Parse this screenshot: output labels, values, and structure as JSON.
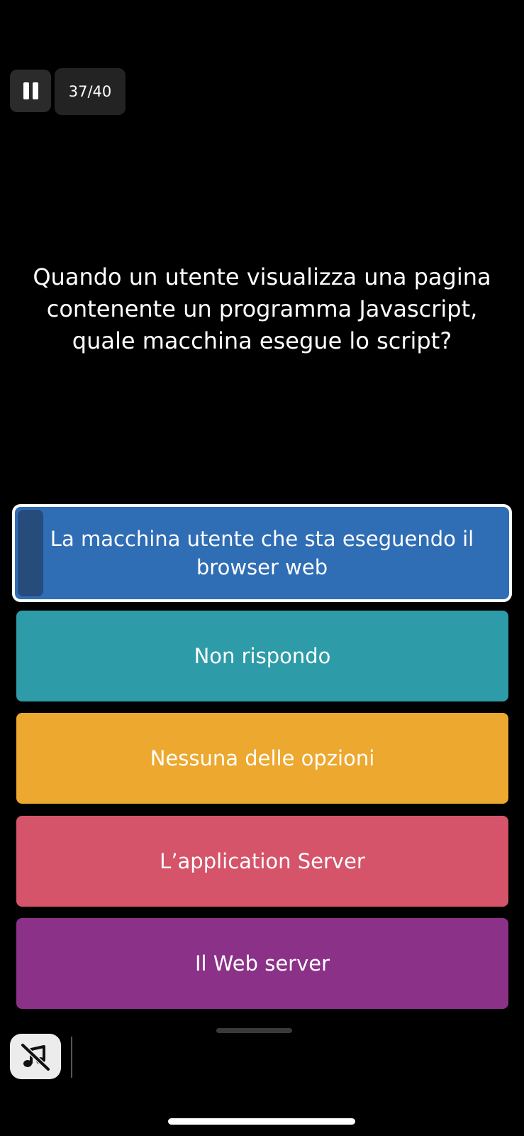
{
  "header": {
    "pause_icon": "pause-icon",
    "counter": "37/40"
  },
  "question": {
    "text": "Quando un utente visualizza una pagina contenente un programma Javascript, quale macchina esegue lo script?"
  },
  "answers": [
    {
      "label": "La macchina utente che sta eseguendo il browser web",
      "color": "#2f6db5",
      "selected": true
    },
    {
      "label": "Non rispondo",
      "color": "#2d9ca8",
      "selected": false
    },
    {
      "label": "Nessuna delle opzioni",
      "color": "#eca82f",
      "selected": false
    },
    {
      "label": "L’application Server",
      "color": "#d5546a",
      "selected": false
    },
    {
      "label": "Il Web server",
      "color": "#8b3188",
      "selected": false
    }
  ],
  "footer": {
    "music_icon": "music-muted-icon"
  }
}
